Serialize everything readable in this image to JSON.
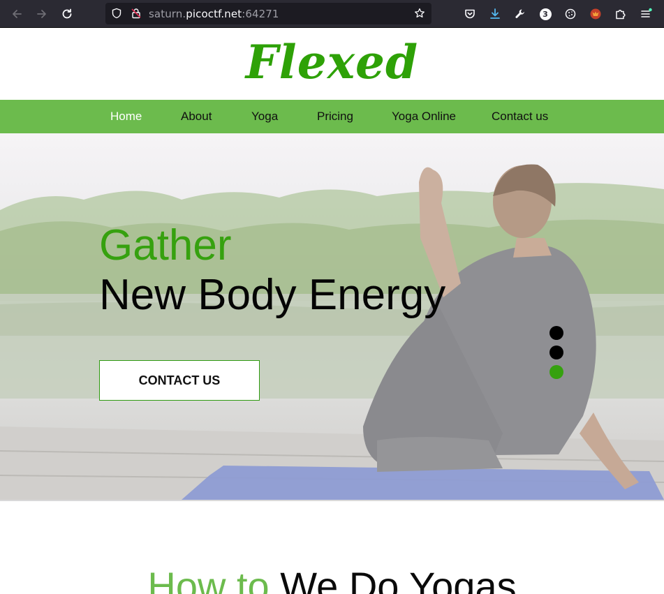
{
  "browser": {
    "url_host_prefix": "saturn.",
    "url_host_main": "picoctf.net",
    "url_port": ":64271",
    "extension_badge_count": "3"
  },
  "site": {
    "logo_text": "Flexed",
    "nav": [
      {
        "label": "Home",
        "active": true
      },
      {
        "label": "About"
      },
      {
        "label": "Yoga"
      },
      {
        "label": "Pricing"
      },
      {
        "label": "Yoga Online"
      },
      {
        "label": "Contact us"
      }
    ]
  },
  "hero": {
    "title_line1": "Gather",
    "title_line2": "New Body Energy",
    "cta_label": "CONTACT US",
    "slides": 3,
    "active_slide": 3
  },
  "section": {
    "title_part1": "How to",
    "title_part2": "We Do Yogas"
  },
  "colors": {
    "brand_green": "#2ea107",
    "nav_green": "#6cbb4d",
    "dot_inactive": "#000000",
    "dot_active": "#36a10f"
  }
}
